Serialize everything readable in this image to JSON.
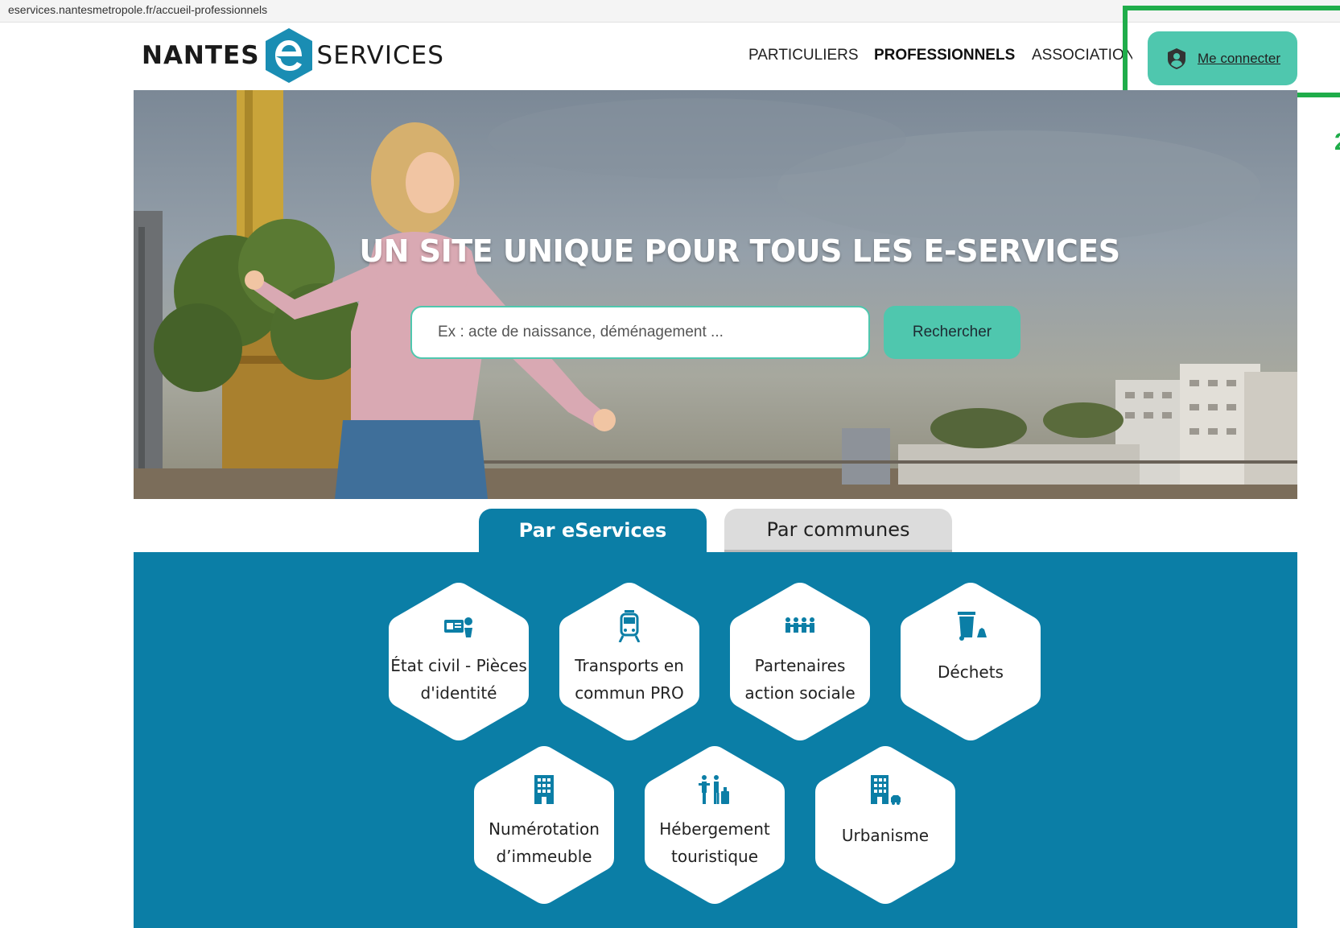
{
  "browser": {
    "url": "eservices.nantesmetropole.fr/accueil-professionnels"
  },
  "header": {
    "logo_left": "NANTES",
    "logo_right": "SERVICES",
    "nav": [
      {
        "label": "PARTICULIERS",
        "active": false
      },
      {
        "label": "PROFESSIONNELS",
        "active": true
      },
      {
        "label": "ASSOCIATIONS",
        "active": false
      }
    ],
    "login_label": "Me connecter"
  },
  "hero": {
    "title": "UN SITE UNIQUE POUR TOUS LES E-SERVICES",
    "search_placeholder": "Ex : acte de naissance, déménagement ...",
    "search_button": "Rechercher"
  },
  "tabs": [
    {
      "label": "Par eServices",
      "active": true
    },
    {
      "label": "Par communes",
      "active": false
    }
  ],
  "services": [
    {
      "label": "État civil - Pièces d'identité",
      "icon": "id-card-icon"
    },
    {
      "label": "Transports en commun PRO",
      "icon": "tram-icon"
    },
    {
      "label": "Partenaires action sociale",
      "icon": "people-group-icon"
    },
    {
      "label": "Déchets",
      "icon": "trash-bin-icon"
    },
    {
      "label": "Numérotation d’immeuble",
      "icon": "building-icon"
    },
    {
      "label": "Hébergement touristique",
      "icon": "traveler-luggage-icon"
    },
    {
      "label": "Urbanisme",
      "icon": "city-planning-icon"
    }
  ],
  "colors": {
    "teal": "#4fc7ae",
    "panel_blue": "#0b7ea6",
    "highlight_green": "#1fad4a"
  }
}
